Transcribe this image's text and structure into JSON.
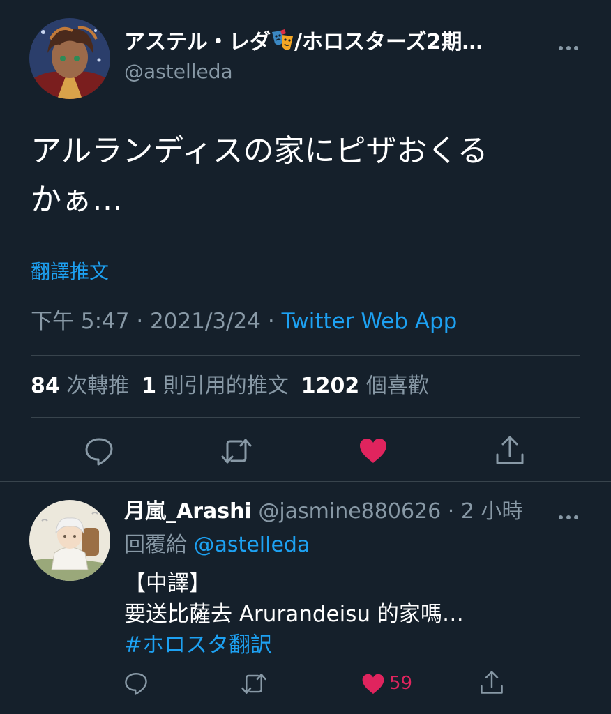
{
  "main_tweet": {
    "display_name_prefix": "アステル・レダ",
    "display_name_suffix": "/ホロスターズ2期…",
    "handle": "@astelleda",
    "text_line1": "アルランディスの家にピザおくる",
    "text_line2": "かぁ…",
    "translate_label": "翻譯推文",
    "time": "下午 5:47",
    "separator": "·",
    "date": "2021/3/24",
    "source": "Twitter Web App",
    "retweets_count": "84",
    "retweets_label": "次轉推",
    "quotes_count": "1",
    "quotes_label": "則引用的推文",
    "likes_count": "1202",
    "likes_label": "個喜歡",
    "liked": true
  },
  "reply": {
    "display_name": "月嵐_Arashi",
    "handle": "@jasmine880626",
    "separator": "·",
    "time_ago": "2 小時",
    "replying_to_label": "回覆給",
    "replying_to_handle": "@astelleda",
    "body_line1": "【中譯】",
    "body_line2": "要送比薩去 Arurandeisu 的家嗎…",
    "hashtag": "#ホロスタ翻訳",
    "like_count": "59",
    "liked": true
  },
  "icons": {
    "more": "more-dots-icon",
    "reply": "reply-bubble-icon",
    "retweet": "retweet-icon",
    "like": "heart-icon",
    "share": "share-icon",
    "name_emoji": "theater-masks-icon"
  },
  "colors": {
    "background": "#15202b",
    "text": "#ffffff",
    "secondary": "#8899a6",
    "link": "#1da1f2",
    "like": "#e0245e",
    "divider": "#38444d"
  }
}
